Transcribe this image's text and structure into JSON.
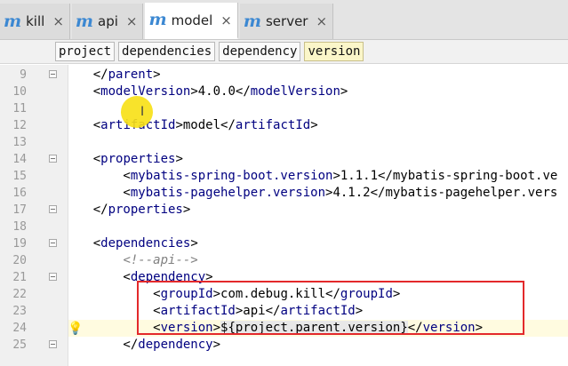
{
  "tabs": [
    {
      "icon": "m",
      "label": "kill",
      "close": "×",
      "active": false
    },
    {
      "icon": "m",
      "label": "api",
      "close": "×",
      "active": false
    },
    {
      "icon": "m",
      "label": "model",
      "close": "×",
      "active": true
    },
    {
      "icon": "m",
      "label": "server",
      "close": "×",
      "active": false
    }
  ],
  "breadcrumb": [
    "project",
    "dependencies",
    "dependency",
    "version"
  ],
  "lines": [
    {
      "n": "9",
      "text": "    </parent>"
    },
    {
      "n": "10",
      "text": "    <modelVersion>4.0.0</modelVersion>"
    },
    {
      "n": "11",
      "text": ""
    },
    {
      "n": "12",
      "text": "    <artifactId>model</artifactId>"
    },
    {
      "n": "13",
      "text": ""
    },
    {
      "n": "14",
      "text": "    <properties>"
    },
    {
      "n": "15",
      "text": "        <mybatis-spring-boot.version>1.1.1</mybatis-spring-boot.ve"
    },
    {
      "n": "16",
      "text": "        <mybatis-pagehelper.version>4.1.2</mybatis-pagehelper.vers"
    },
    {
      "n": "17",
      "text": "    </properties>"
    },
    {
      "n": "18",
      "text": ""
    },
    {
      "n": "19",
      "text": "    <dependencies>"
    },
    {
      "n": "20",
      "text": "        <!--api-->"
    },
    {
      "n": "21",
      "text": "        <dependency>"
    },
    {
      "n": "22",
      "text": "            <groupId>com.debug.kill</groupId>"
    },
    {
      "n": "23",
      "text": "            <artifactId>api</artifactId>"
    },
    {
      "n": "24",
      "text": "            <version>${project.parent.version}</version>"
    },
    {
      "n": "25",
      "text": "        </dependency>"
    }
  ],
  "current_line": "24",
  "colors": {
    "tag": "#000080",
    "comment": "#808080",
    "highlight_box": "#e3292b",
    "cursor_marker": "#f7e014"
  }
}
